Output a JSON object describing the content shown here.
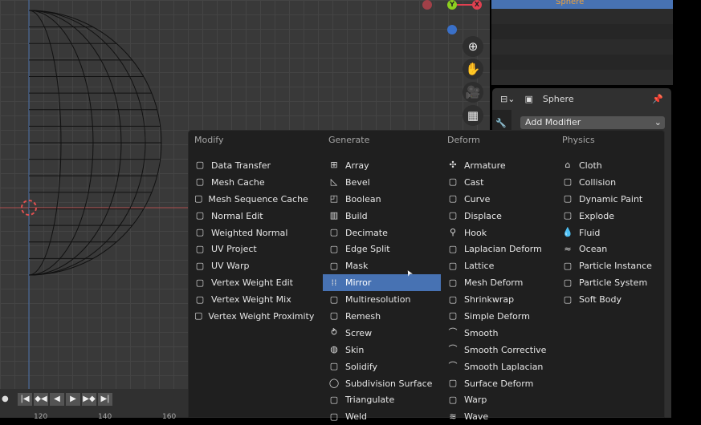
{
  "outliner": {
    "selected_object": "Sphere"
  },
  "properties": {
    "object_name": "Sphere",
    "add_modifier": "Add Modifier"
  },
  "timeline": {
    "ruler": [
      "120",
      "140",
      "160"
    ],
    "controls": [
      "jump-start",
      "prev-keyframe",
      "play-reverse",
      "play",
      "next-keyframe",
      "jump-end"
    ]
  },
  "gizmo": {
    "y": "Y",
    "x": "X"
  },
  "colors": {
    "highlight": "#4772b3",
    "menu_bg": "#1f1f1f",
    "viewport_bg": "#393939",
    "axis_x": "#e04050",
    "axis_y": "#8ccf1f",
    "axis_z": "#3a70c8"
  },
  "menu": {
    "columns": [
      {
        "title": "Modify",
        "items": [
          {
            "label": "Data Transfer",
            "icon": "data-transfer-icon"
          },
          {
            "label": "Mesh Cache",
            "icon": "mesh-cache-icon"
          },
          {
            "label": "Mesh Sequence Cache",
            "icon": "mesh-sequence-cache-icon"
          },
          {
            "label": "Normal Edit",
            "icon": "normal-edit-icon"
          },
          {
            "label": "Weighted Normal",
            "icon": "weighted-normal-icon"
          },
          {
            "label": "UV Project",
            "icon": "uv-project-icon"
          },
          {
            "label": "UV Warp",
            "icon": "uv-warp-icon"
          },
          {
            "label": "Vertex Weight Edit",
            "icon": "vertex-weight-icon"
          },
          {
            "label": "Vertex Weight Mix",
            "icon": "vertex-weight-icon"
          },
          {
            "label": "Vertex Weight Proximity",
            "icon": "vertex-weight-icon"
          }
        ]
      },
      {
        "title": "Generate",
        "items": [
          {
            "label": "Array",
            "icon": "array-icon"
          },
          {
            "label": "Bevel",
            "icon": "bevel-icon"
          },
          {
            "label": "Boolean",
            "icon": "boolean-icon"
          },
          {
            "label": "Build",
            "icon": "build-icon"
          },
          {
            "label": "Decimate",
            "icon": "decimate-icon"
          },
          {
            "label": "Edge Split",
            "icon": "edge-split-icon"
          },
          {
            "label": "Mask",
            "icon": "mask-icon"
          },
          {
            "label": "Mirror",
            "icon": "mirror-icon",
            "highlighted": true
          },
          {
            "label": "Multiresolution",
            "icon": "multires-icon"
          },
          {
            "label": "Remesh",
            "icon": "remesh-icon"
          },
          {
            "label": "Screw",
            "icon": "screw-icon"
          },
          {
            "label": "Skin",
            "icon": "skin-icon"
          },
          {
            "label": "Solidify",
            "icon": "solidify-icon"
          },
          {
            "label": "Subdivision Surface",
            "icon": "subsurf-icon"
          },
          {
            "label": "Triangulate",
            "icon": "triangulate-icon"
          },
          {
            "label": "Weld",
            "icon": "weld-icon"
          }
        ]
      },
      {
        "title": "Deform",
        "items": [
          {
            "label": "Armature",
            "icon": "armature-icon"
          },
          {
            "label": "Cast",
            "icon": "cast-icon"
          },
          {
            "label": "Curve",
            "icon": "curve-icon"
          },
          {
            "label": "Displace",
            "icon": "displace-icon"
          },
          {
            "label": "Hook",
            "icon": "hook-icon"
          },
          {
            "label": "Laplacian Deform",
            "icon": "laplacian-icon"
          },
          {
            "label": "Lattice",
            "icon": "lattice-icon"
          },
          {
            "label": "Mesh Deform",
            "icon": "mesh-deform-icon"
          },
          {
            "label": "Shrinkwrap",
            "icon": "shrinkwrap-icon"
          },
          {
            "label": "Simple Deform",
            "icon": "simple-deform-icon"
          },
          {
            "label": "Smooth",
            "icon": "smooth-icon"
          },
          {
            "label": "Smooth Corrective",
            "icon": "smooth-icon"
          },
          {
            "label": "Smooth Laplacian",
            "icon": "smooth-icon"
          },
          {
            "label": "Surface Deform",
            "icon": "surface-deform-icon"
          },
          {
            "label": "Warp",
            "icon": "warp-icon"
          },
          {
            "label": "Wave",
            "icon": "wave-icon"
          }
        ]
      },
      {
        "title": "Physics",
        "items": [
          {
            "label": "Cloth",
            "icon": "cloth-icon"
          },
          {
            "label": "Collision",
            "icon": "collision-icon"
          },
          {
            "label": "Dynamic Paint",
            "icon": "dynamic-paint-icon"
          },
          {
            "label": "Explode",
            "icon": "explode-icon"
          },
          {
            "label": "Fluid",
            "icon": "fluid-icon"
          },
          {
            "label": "Ocean",
            "icon": "ocean-icon"
          },
          {
            "label": "Particle Instance",
            "icon": "particle-instance-icon"
          },
          {
            "label": "Particle System",
            "icon": "particle-system-icon"
          },
          {
            "label": "Soft Body",
            "icon": "soft-body-icon"
          }
        ]
      }
    ]
  }
}
